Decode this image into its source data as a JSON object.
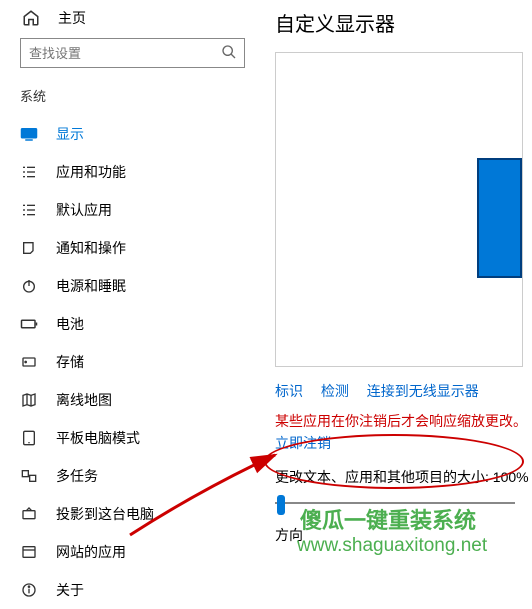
{
  "home": {
    "label": "主页"
  },
  "search": {
    "placeholder": "查找设置"
  },
  "group": {
    "label": "系统"
  },
  "nav": [
    {
      "label": "显示"
    },
    {
      "label": "应用和功能"
    },
    {
      "label": "默认应用"
    },
    {
      "label": "通知和操作"
    },
    {
      "label": "电源和睡眠"
    },
    {
      "label": "电池"
    },
    {
      "label": "存储"
    },
    {
      "label": "离线地图"
    },
    {
      "label": "平板电脑模式"
    },
    {
      "label": "多任务"
    },
    {
      "label": "投影到这台电脑"
    },
    {
      "label": "网站的应用"
    },
    {
      "label": "关于"
    }
  ],
  "main": {
    "title": "自定义显示器",
    "link_identify": "标识",
    "link_detect": "检测",
    "link_wireless": "连接到无线显示器",
    "warn": "某些应用在你注销后才会响应缩放更改。",
    "logout": "立即注销",
    "scale_label": "更改文本、应用和其他项目的大小: 100%",
    "direction_label": "方向"
  },
  "watermark": {
    "line1": "傻瓜一键重装系统",
    "line2": "www.shaguaxitong.net"
  }
}
